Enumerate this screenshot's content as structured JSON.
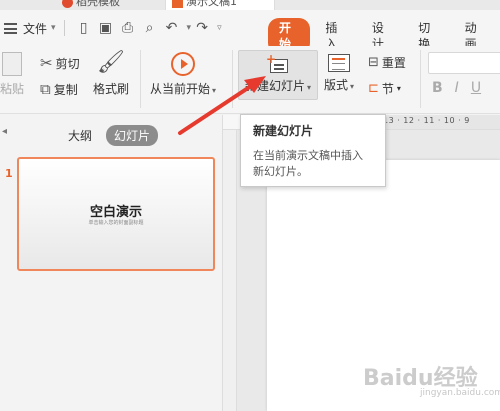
{
  "top_tabs": [
    {
      "label": "稻壳模板"
    },
    {
      "label": "演示文稿1"
    }
  ],
  "menubar": {
    "file_label": "文件",
    "tabs": [
      {
        "label": "开始",
        "active": true
      },
      {
        "label": "插入"
      },
      {
        "label": "设计"
      },
      {
        "label": "切换"
      },
      {
        "label": "动画"
      }
    ]
  },
  "ribbon": {
    "paste_label": "粘贴",
    "cut_label": "剪切",
    "copy_label": "复制",
    "format_painter_label": "格式刷",
    "from_current_label": "从当前开始",
    "new_slide_label": "新建幻灯片",
    "layout_label": "版式",
    "reset_label": "重置",
    "section_label": "节",
    "bold_label": "B",
    "italic_label": "I",
    "underline_label": "U"
  },
  "tooltip": {
    "title": "新建幻灯片",
    "description": "在当前演示文稿中插入新幻灯片。"
  },
  "left_panel": {
    "outline_tab": "大纲",
    "slides_tab": "幻灯片",
    "slide_number": "1",
    "thumb_title": "空白演示",
    "thumb_subtitle": "单击输入您的封面副标题"
  },
  "ruler": {
    "marks": "13 · 12 · 11 · 10 · 9"
  },
  "watermark": {
    "text": "Baidu经验",
    "sub": "jingyan.baidu.com"
  },
  "colors": {
    "accent": "#e8632b",
    "arrow": "#e63a2e",
    "thumb_border": "#f0875a"
  }
}
